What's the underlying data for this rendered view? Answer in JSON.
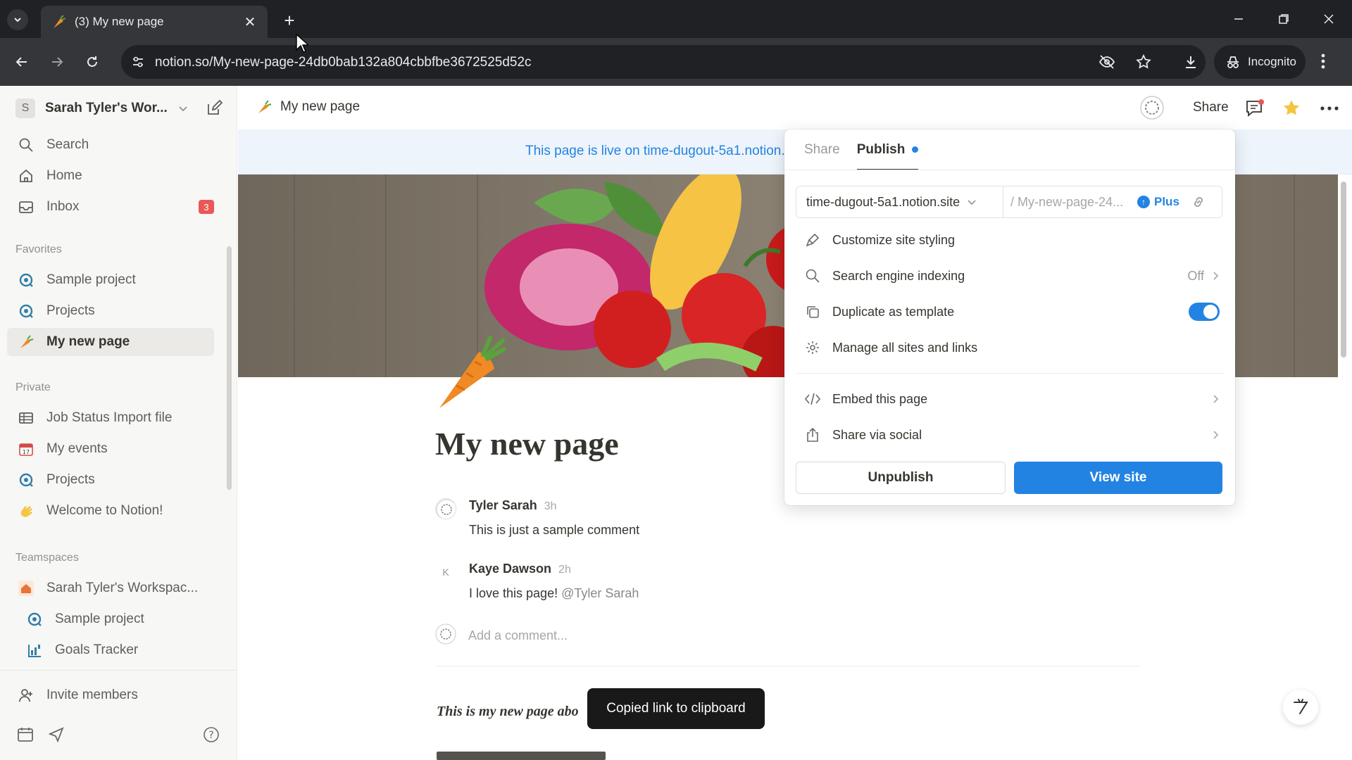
{
  "browser": {
    "tab_title": "(3) My new page",
    "tab_close": "✕",
    "new_tab": "+",
    "url": "notion.so/My-new-page-24db0bab132a804cbbfbe3672525d52c",
    "incognito_label": "Incognito"
  },
  "sidebar": {
    "workspace_initial": "S",
    "workspace_name": "Sarah Tyler's Wor...",
    "nav": [
      {
        "label": "Search",
        "icon": "search-icon"
      },
      {
        "label": "Home",
        "icon": "home-icon"
      },
      {
        "label": "Inbox",
        "icon": "inbox-icon",
        "badge": "3"
      }
    ],
    "favorites_label": "Favorites",
    "favorites": [
      {
        "label": "Sample project",
        "icon": "project-icon"
      },
      {
        "label": "Projects",
        "icon": "project-icon"
      },
      {
        "label": "My new page",
        "icon": "carrot-icon",
        "active": true
      }
    ],
    "private_label": "Private",
    "private": [
      {
        "label": "Job Status Import file",
        "icon": "table-icon"
      },
      {
        "label": "My events",
        "icon": "calendar-icon"
      },
      {
        "label": "Projects",
        "icon": "project-icon"
      },
      {
        "label": "Welcome to Notion!",
        "icon": "wave-icon"
      }
    ],
    "teamspaces_label": "Teamspaces",
    "teamspaces": [
      {
        "label": "Sarah Tyler's Workspac...",
        "icon": "house-icon"
      },
      {
        "label": "Sample project",
        "icon": "project-icon"
      },
      {
        "label": "Goals Tracker",
        "icon": "goals-icon"
      }
    ],
    "invite_label": "Invite members"
  },
  "topbar": {
    "page_title": "My new page",
    "share_label": "Share"
  },
  "banner": {
    "text": "This page is live on time-dugout-5a1.notion.site"
  },
  "page": {
    "title": "My new page",
    "comments": [
      {
        "author": "Tyler Sarah",
        "time": "3h",
        "text": "This is just a sample comment",
        "avatar": ""
      },
      {
        "author": "Kaye Dawson",
        "time": "2h",
        "text": "I love this page! ",
        "mention": "@Tyler Sarah",
        "avatar": "K"
      }
    ],
    "add_comment_placeholder": "Add a comment...",
    "italic_text": "This is my new page abo"
  },
  "publish_panel": {
    "tab_share": "Share",
    "tab_publish": "Publish",
    "domain": "time-dugout-5a1.notion.site",
    "path": "/ My-new-page-24...",
    "plan_label": "Plus",
    "rows": [
      {
        "label": "Customize site styling",
        "icon": "brush-icon"
      },
      {
        "label": "Search engine indexing",
        "icon": "search-icon",
        "value": "Off"
      },
      {
        "label": "Duplicate as template",
        "icon": "duplicate-icon",
        "toggle_on": true
      },
      {
        "label": "Manage all sites and links",
        "icon": "gear-icon"
      },
      {
        "label": "Embed this page",
        "icon": "code-icon"
      },
      {
        "label": "Share via social",
        "icon": "share-out-icon"
      }
    ],
    "unpublish_label": "Unpublish",
    "view_site_label": "View site"
  },
  "toast": {
    "text": "Copied link to clipboard"
  },
  "colors": {
    "accent": "#2383e2",
    "badge": "#eb5757",
    "chrome_dark": "#202124",
    "chrome_toolbar": "#35363a"
  }
}
